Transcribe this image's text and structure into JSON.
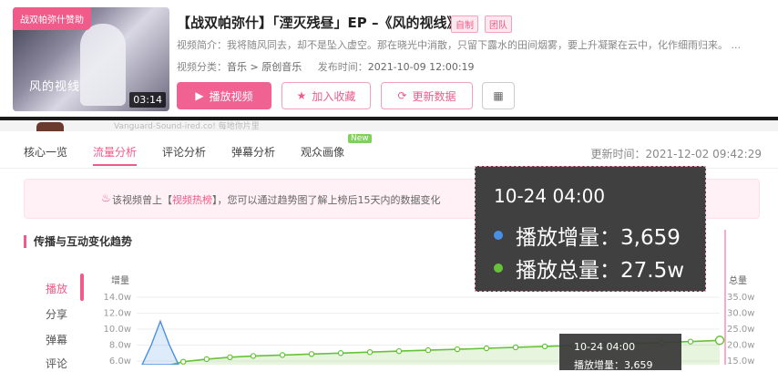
{
  "video": {
    "title": "【战双帕弥什】「湮灭残昼」EP –《风的视线》",
    "tags": [
      "自制",
      "团队"
    ],
    "thumb_badge": "战双帕弥什赞助",
    "thumb_caption": "风的视线",
    "duration": "03:14",
    "intro": "视频简介：我将随风同去，却不是坠入虚空。那在晓光中消散，只留下露水的田间烟雾，要上升凝聚在云中，化作细雨归来。 ...",
    "category_label": "视频分类：",
    "category": "音乐 > 原创音乐",
    "publish_label": "发布时间：",
    "publish_time": "2021-10-09 12:00:19"
  },
  "buttons": {
    "play": "播放视频",
    "favorite": "加入收藏",
    "update": "更新数据"
  },
  "strip_text": "Vanguard-Sound-ired.co! 每地你片里",
  "tabs": [
    "核心一览",
    "流量分析",
    "评论分析",
    "弹幕分析",
    "观众画像"
  ],
  "new_badge": "New",
  "update_time": "更新时间：2021-12-02 09:42:29",
  "notice": {
    "prefix": "该视频曾上【",
    "highlight": "视频热榜",
    "suffix": "】，您可以通过趋势图了解上榜后15天内的数据变化"
  },
  "section_title": "传播与互动变化趋势",
  "side_items": [
    "播放",
    "分享",
    "弹幕",
    "评论"
  ],
  "tooltip": {
    "date": "10-24 04:00",
    "row1_label": "播放增量：",
    "row1_value": "3,659",
    "row2_label": "播放总量：",
    "row2_value": "27.5w",
    "dot1": "#4a90e2",
    "dot2": "#67c23a"
  },
  "tooltip_small": {
    "date": "10-24 04:00",
    "row1": "播放增量：3,659"
  },
  "chart_data": {
    "type": "line",
    "left_axis_label": "增量",
    "right_axis_label": "总量",
    "left_ticks": [
      "14.0w",
      "12.0w",
      "10.0w",
      "8.0w",
      "6.0w"
    ],
    "right_ticks": [
      "35.0w",
      "30.0w",
      "25.0w",
      "20.0w",
      "15.0w"
    ],
    "left_ylim": [
      6.0,
      14.0
    ],
    "right_ylim": [
      15.0,
      35.0
    ],
    "series": [
      {
        "name": "播放增量",
        "color": "#4a90e2",
        "x": [
          0,
          0.04,
          0.08,
          0.12,
          0.16
        ],
        "values": [
          0,
          8.0,
          11.0,
          8.0,
          0
        ]
      },
      {
        "name": "播放总量",
        "color": "#67c23a",
        "x": [
          0.0,
          0.04,
          0.08,
          0.12,
          0.16,
          0.2,
          0.25,
          0.3,
          0.35,
          0.4,
          0.45,
          0.5,
          0.55,
          0.6,
          0.65,
          0.7,
          0.75,
          0.8,
          0.85,
          0.9,
          0.95,
          1.0
        ],
        "values": [
          10.0,
          13.0,
          14.8,
          15.6,
          16.2,
          16.6,
          16.9,
          17.2,
          17.5,
          17.8,
          18.1,
          18.4,
          18.7,
          19.0,
          19.3,
          19.6,
          19.9,
          20.2,
          20.5,
          20.8,
          21.1,
          21.5
        ]
      }
    ]
  }
}
